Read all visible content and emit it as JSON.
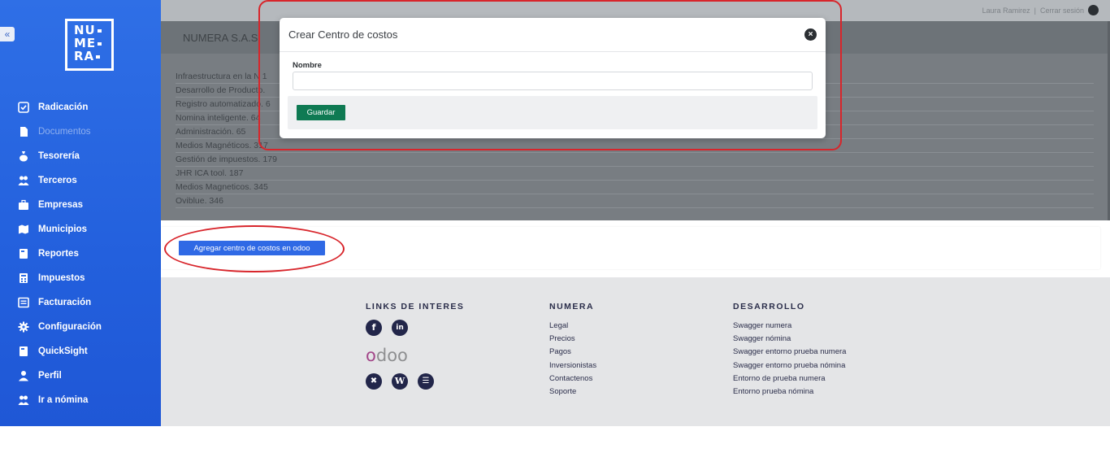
{
  "user": {
    "name": "Laura Ramirez",
    "separator": "|",
    "logout": "Cerrar sesión"
  },
  "company": {
    "name": "NUMERA S.A.S"
  },
  "logo": {
    "line1": "NU",
    "line2": "ME",
    "line3": "RA"
  },
  "sidebar": {
    "collapse_icon": "«",
    "items": [
      {
        "label": "Radicación",
        "icon": "checkbox-icon"
      },
      {
        "label": "Documentos",
        "icon": "document-icon"
      },
      {
        "label": "Tesorería",
        "icon": "money-bag-icon"
      },
      {
        "label": "Terceros",
        "icon": "users-icon"
      },
      {
        "label": "Empresas",
        "icon": "briefcase-icon"
      },
      {
        "label": "Municipios",
        "icon": "map-icon"
      },
      {
        "label": "Reportes",
        "icon": "book-icon"
      },
      {
        "label": "Impuestos",
        "icon": "calculator-icon"
      },
      {
        "label": "Facturación",
        "icon": "invoice-icon"
      },
      {
        "label": "Configuración",
        "icon": "gear-icon"
      },
      {
        "label": "QuickSight",
        "icon": "book-icon"
      },
      {
        "label": "Perfil",
        "icon": "user-icon"
      },
      {
        "label": "Ir a nómina",
        "icon": "users-icon"
      }
    ]
  },
  "cost_centers": [
    "Infraestructura en la N 1",
    "Desarrollo de Producto.",
    "Registro automatizado. 6",
    "Nomina inteligente. 64",
    "Administración. 65",
    "Medios Magnéticos. 317",
    "Gestión de impuestos. 179",
    "JHR ICA tool. 187",
    "Medios Magneticos. 345",
    "Oviblue. 346"
  ],
  "add_button": "Agregar centro de costos en odoo",
  "modal": {
    "title": "Crear Centro de costos",
    "close_icon": "×",
    "field_label": "Nombre",
    "field_value": "",
    "field_placeholder": "",
    "save_label": "Guardar"
  },
  "footer": {
    "links_title": "LINKS DE INTERES",
    "social_top": [
      "facebook-icon",
      "linkedin-icon"
    ],
    "odoo_text": "odoo",
    "social_bottom": [
      "confluence-icon",
      "wikipedia-icon",
      "support-icon"
    ],
    "numera_title": "NUMERA",
    "numera_links": [
      "Legal",
      "Precios",
      "Pagos",
      "Inversionistas",
      "Contactenos",
      "Soporte"
    ],
    "dev_title": "DESARROLLO",
    "dev_links": [
      "Swagger numera",
      "Swagger nómina",
      "Swagger entorno prueba numera",
      "Swagger entorno prueba nómina",
      "Entorno de prueba numera",
      "Entorno prueba nómina"
    ]
  },
  "colors": {
    "sidebar": "#2f6fe6",
    "primary_button": "#2f69e5",
    "save_button": "#0f7a53",
    "annotation": "#d8252b"
  }
}
